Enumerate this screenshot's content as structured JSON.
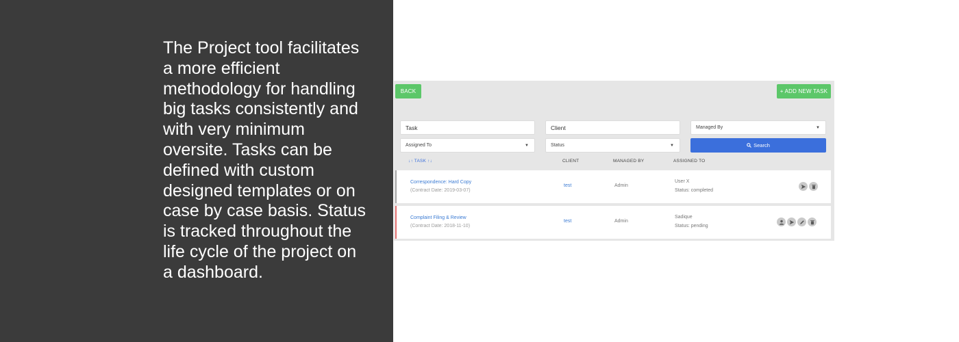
{
  "description": "The Project tool facilitates a more efficient methodology for handling big tasks consistently and with very minimum oversite. Tasks can be defined with custom designed templates or on case by case basis. Status is tracked throughout the life cycle of the project on a dashboard.",
  "toolbar": {
    "back_label": "BACK",
    "add_label": "+ ADD NEW TASK"
  },
  "filters": {
    "task_placeholder": "Task",
    "client_placeholder": "Client",
    "managed_by": "Managed By",
    "assigned_to": "Assigned To",
    "status": "Status",
    "search_label": "Search"
  },
  "table": {
    "headers": {
      "task": "↓↑ TASK ↑↓",
      "client": "CLIENT",
      "managed_by": "MANAGED BY",
      "assigned_to": "ASSIGNED TO"
    },
    "rows": [
      {
        "task": "Correspondence: Hard Copy",
        "date": "(Contract Date: 2019-03-07)",
        "client": "test",
        "managed_by": "Admin",
        "assigned_to": "User X",
        "status": "Status: completed"
      },
      {
        "task": "Complaint Filing & Review",
        "date": "(Contract Date: 2018-11-10)",
        "client": "test",
        "managed_by": "Admin",
        "assigned_to": "Sadique",
        "status": "Status: pending"
      }
    ]
  },
  "colors": {
    "accent_green": "#5cc769",
    "accent_blue": "#3b6fdc",
    "row_completed_border": "#a6a6a6",
    "row_pending_border": "#e57373",
    "dark_panel": "#3b3b3b"
  },
  "icons": {
    "row1_actions": [
      "send-icon",
      "delete-icon"
    ],
    "row2_actions": [
      "user-icon",
      "send-icon",
      "edit-icon",
      "delete-icon"
    ]
  }
}
